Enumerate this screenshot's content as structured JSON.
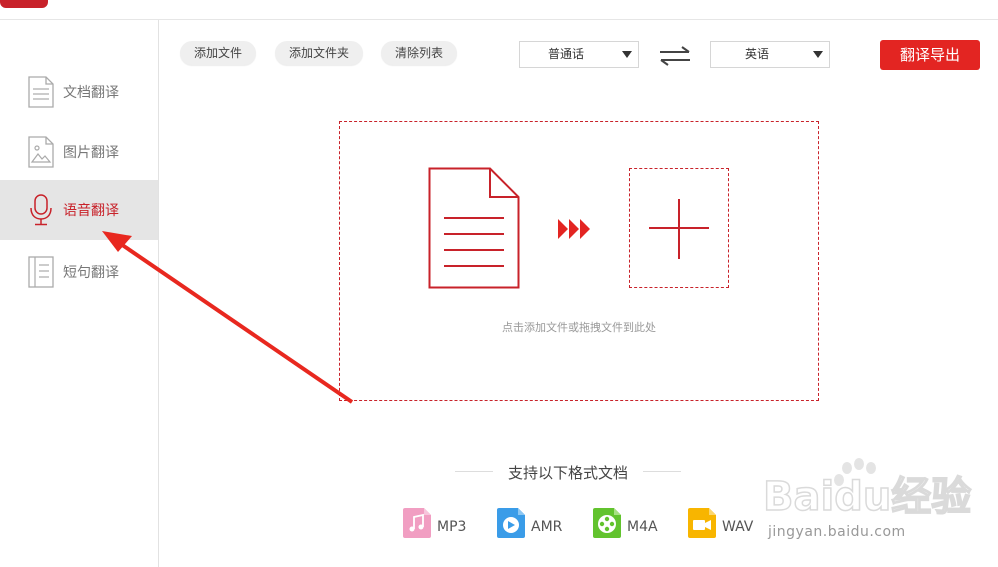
{
  "sidebar": {
    "items": [
      {
        "label": "文档翻译",
        "icon": "document-icon"
      },
      {
        "label": "图片翻译",
        "icon": "image-icon"
      },
      {
        "label": "语音翻译",
        "icon": "microphone-icon",
        "active": true
      },
      {
        "label": "短句翻译",
        "icon": "sentence-icon"
      }
    ]
  },
  "toolbar": {
    "add_file": "添加文件",
    "add_folder": "添加文件夹",
    "clear_list": "清除列表",
    "source_lang": "普通话",
    "target_lang": "英语",
    "export": "翻译导出"
  },
  "dropzone": {
    "hint": "点击添加文件或拖拽文件到此处"
  },
  "formats": {
    "title": "支持以下格式文档",
    "items": [
      {
        "name": "MP3",
        "color": "#f19ec2",
        "icon": "music-note-icon"
      },
      {
        "name": "AMR",
        "color": "#3a9ce8",
        "icon": "play-icon"
      },
      {
        "name": "M4A",
        "color": "#62c32e",
        "icon": "film-reel-icon"
      },
      {
        "name": "WAV",
        "color": "#f8b500",
        "icon": "video-camera-icon"
      }
    ]
  },
  "colors": {
    "accent": "#c8222a",
    "export_button": "#e32522",
    "active_bg": "#e5e5e5"
  },
  "watermark": {
    "brand": "Baidu经验",
    "url": "jingyan.baidu.com"
  }
}
